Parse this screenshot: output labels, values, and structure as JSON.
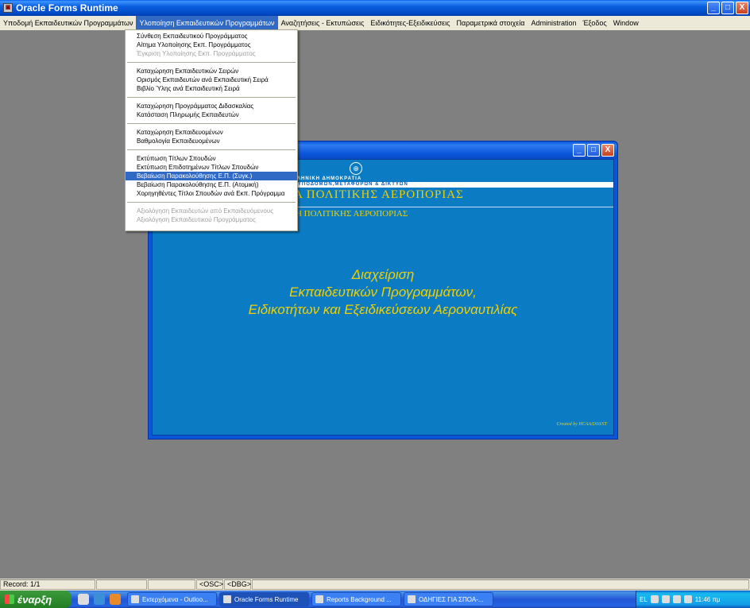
{
  "window": {
    "title": "Oracle Forms Runtime",
    "controls": [
      "_",
      "□",
      "X"
    ]
  },
  "menubar": [
    "Υποδομή Εκπαιδευτικών Προγραμμάτων",
    "Υλοποίηση Εκπαιδευτικών Προγραμμάτων",
    "Αναζητήσεις - Εκτυπώσεις",
    "Ειδικότητες-Εξειδικεύσεις",
    "Παραμετρικά στοιχεία",
    "Administration",
    "Έξοδος",
    "Window"
  ],
  "dropdown": {
    "groups": [
      [
        {
          "label": "Σύνθεση Εκπαιδευτικού Προγράμματος",
          "state": "normal"
        },
        {
          "label": "Αίτημα Υλοποίησης Εκπ. Προγράμματος",
          "state": "normal"
        },
        {
          "label": "Έγκριση Υλοποίησης Εκπ. Προγράμματος",
          "state": "disabled"
        }
      ],
      [
        {
          "label": "Καταχώρηση Εκπαιδευτικών Σειρών",
          "state": "normal"
        },
        {
          "label": "Ορισμός Εκπαιδευτών ανά Εκπαιδευτική Σειρά",
          "state": "normal"
        },
        {
          "label": "Βιβλίο Ύλης ανά Εκπαιδευτική Σειρά",
          "state": "normal"
        }
      ],
      [
        {
          "label": "Καταχώρηση Προγράμματος Διδασκαλίας",
          "state": "normal"
        },
        {
          "label": "Κατάσταση Πληρωμής Εκπαιδευτών",
          "state": "normal"
        }
      ],
      [
        {
          "label": "Καταχώρηση Εκπαιδευομένων",
          "state": "normal"
        },
        {
          "label": "Βαθμολογία Εκπαιδευομένων",
          "state": "normal"
        }
      ],
      [
        {
          "label": "Εκτύπωση Τίτλων Σπουδών",
          "state": "normal"
        },
        {
          "label": "Εκτύπωση Επιδοτημένων Τίτλων Σπουδών",
          "state": "normal"
        },
        {
          "label": "Βεβαίωση Παρακολούθησης Ε.Π. (Συγκ.)",
          "state": "hover"
        },
        {
          "label": "Βεβαίωση Παρακολούθησης Ε.Π. (Ατομική)",
          "state": "normal"
        },
        {
          "label": "Χορηγηθέντες Τίτλοι Σπουδών ανά Εκπ. Πρόγραμμα",
          "state": "normal"
        }
      ],
      [
        {
          "label": "Αξιολόγηση Εκπαιδευτών από Εκπαιδευόμενους",
          "state": "disabled"
        },
        {
          "label": "Αξιολόγηση Εκπαιδευτικού Προγράμματος",
          "state": "disabled"
        }
      ]
    ]
  },
  "inner_window": {
    "controls": [
      "_",
      "□",
      "X"
    ],
    "banner_line1": "ΕΛΛΗΝΙΚΗ ΔΗΜΟΚΡΑΤΙΑ",
    "banner_line2": "ΙΟ ΥΠΟΔΟΜΩΝ,ΜΕΤΑΦΟΡΩΝ & ΔΙΚΤΥΩΝ",
    "banner_line3": "ΙΑ ΠΟΛΙΤΙΚΗΣ ΑΕΡΟΠΟΡΙΑΣ",
    "banner_line4": "ΛΗ ΠΟΛΙΤΙΚΗΣ ΑΕΡΟΠΟΡΙΑΣ",
    "headline": [
      "Διαχείριση",
      "Εκπαιδευτικών Προγραμμάτων,",
      "Ειδικοτήτων και Εξειδικεύσεων Αεροναυτιλίας"
    ],
    "credit": "Created by HCAA/D10/ST"
  },
  "statusbar": {
    "record": "Record: 1/1",
    "osc": "<OSC>",
    "dbg": "<DBG>"
  },
  "taskbar": {
    "start_label": "έναρξη",
    "tasks": [
      {
        "label": "Εισερχόμενα - Outloo...",
        "active": false
      },
      {
        "label": "Oracle Forms Runtime",
        "active": true
      },
      {
        "label": "Reports Background ...",
        "active": false
      },
      {
        "label": "ΟΔΗΓΙΕΣ ΓΙΑ ΣΠΟΑ-...",
        "active": false
      }
    ],
    "lang": "EL",
    "clock": "11:46 πμ"
  }
}
